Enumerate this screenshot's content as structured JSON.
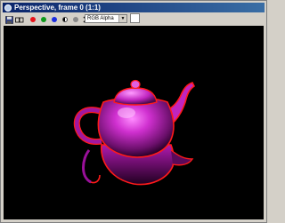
{
  "window": {
    "title": "Perspective, frame 0 (1:1)"
  },
  "toolbar": {
    "channel_select": "RGB Alpha",
    "red_color": "#e8131b",
    "green_color": "#0e9a1c",
    "blue_color": "#1b2de0"
  },
  "render": {
    "background": "#000000",
    "teapot_color": "#cc22cc",
    "outline_color": "#ff1a1a"
  }
}
